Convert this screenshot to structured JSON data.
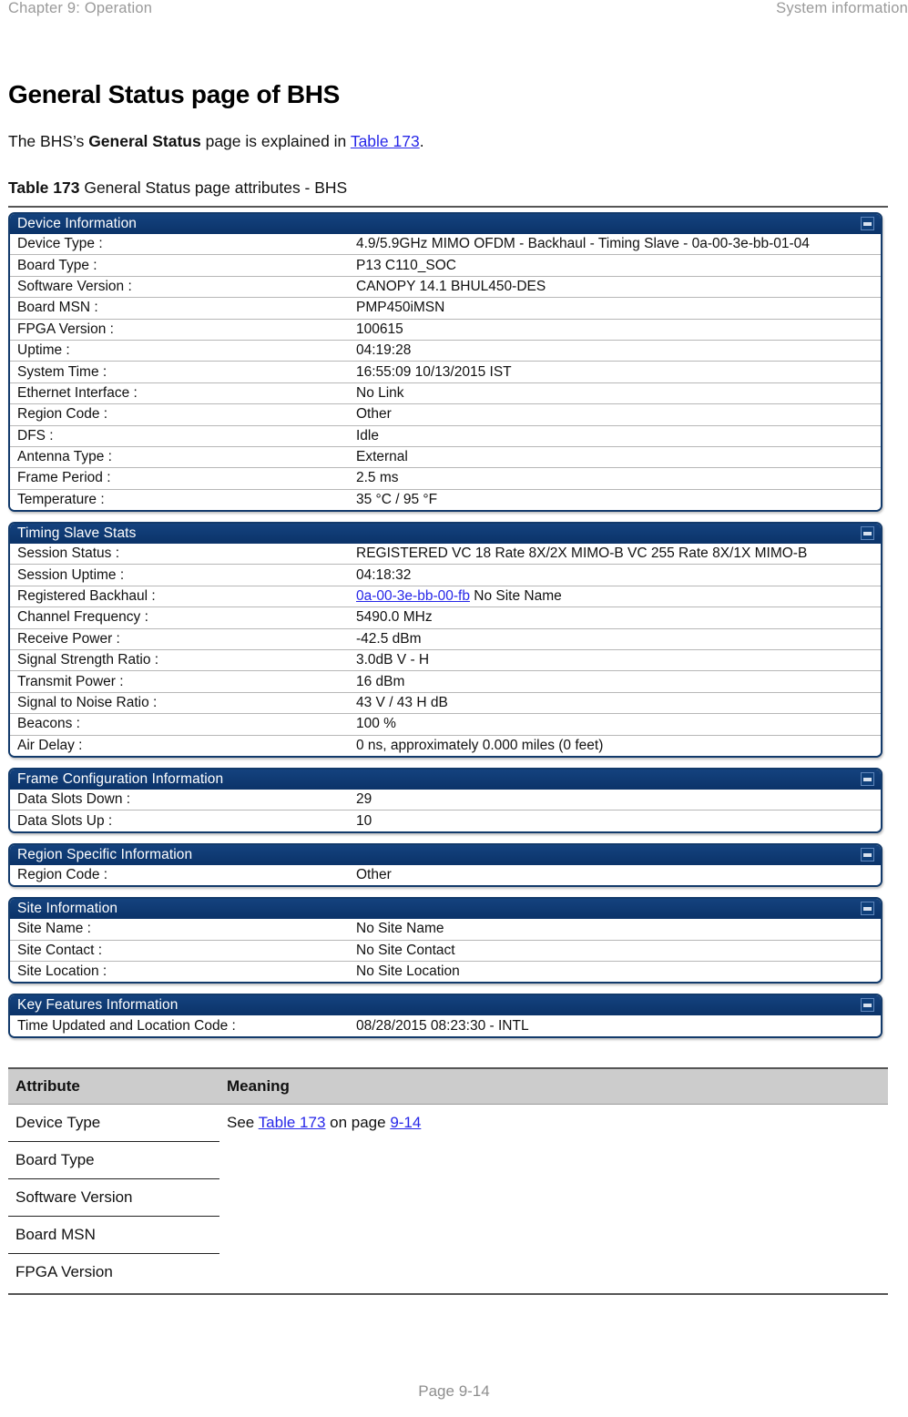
{
  "running_head": {
    "left": "Chapter 9:  Operation",
    "right": "System information"
  },
  "section": {
    "title": "General Status page of BHS",
    "intro_prefix": "The BHS’s ",
    "intro_bold": "General Status",
    "intro_middle": " page is explained in ",
    "intro_link": "Table 173",
    "intro_suffix": ".",
    "caption_label": "Table 173",
    "caption_text": " General Status page attributes - BHS"
  },
  "screenshot": {
    "panels": [
      {
        "title": "Device Information",
        "minimize_icon": "minimize-icon",
        "rows": [
          {
            "label": "Device Type :",
            "value": "4.9/5.9GHz MIMO OFDM - Backhaul - Timing Slave - 0a-00-3e-bb-01-04"
          },
          {
            "label": "Board Type :",
            "value": "P13 C110_SOC"
          },
          {
            "label": "Software Version :",
            "value": "CANOPY 14.1 BHUL450-DES"
          },
          {
            "label": "Board MSN :",
            "value": "PMP450iMSN"
          },
          {
            "label": "FPGA Version :",
            "value": "100615"
          },
          {
            "label": "Uptime :",
            "value": "04:19:28"
          },
          {
            "label": "System Time :",
            "value": "16:55:09 10/13/2015 IST"
          },
          {
            "label": "Ethernet Interface :",
            "value": "No Link"
          },
          {
            "label": "Region Code :",
            "value": "Other"
          },
          {
            "label": "DFS :",
            "value": "Idle"
          },
          {
            "label": "Antenna Type :",
            "value": "External"
          },
          {
            "label": "Frame Period :",
            "value": "2.5 ms"
          },
          {
            "label": "Temperature :",
            "value": "35 °C / 95 °F"
          }
        ]
      },
      {
        "title": "Timing Slave Stats",
        "minimize_icon": "minimize-icon",
        "rows": [
          {
            "label": "Session Status :",
            "value": "REGISTERED VC 18 Rate 8X/2X MIMO-B VC 255 Rate 8X/1X MIMO-B"
          },
          {
            "label": "Session Uptime :",
            "value": "04:18:32"
          },
          {
            "label": "Registered Backhaul :",
            "value": "",
            "link_text": "0a-00-3e-bb-00-fb",
            "value_after_link": " No Site Name"
          },
          {
            "label": "Channel Frequency :",
            "value": "5490.0 MHz"
          },
          {
            "label": "Receive Power :",
            "value": "-42.5 dBm"
          },
          {
            "label": "Signal Strength Ratio :",
            "value": "3.0dB V - H"
          },
          {
            "label": "Transmit Power :",
            "value": "16 dBm"
          },
          {
            "label": "Signal to Noise Ratio :",
            "value": "43 V / 43 H dB"
          },
          {
            "label": "Beacons :",
            "value": "100 %"
          },
          {
            "label": "Air Delay :",
            "value": "0 ns, approximately 0.000 miles (0 feet)"
          }
        ]
      },
      {
        "title": "Frame Configuration Information",
        "minimize_icon": "minimize-icon",
        "rows": [
          {
            "label": "Data Slots Down :",
            "value": "29"
          },
          {
            "label": "Data Slots Up :",
            "value": "10"
          }
        ]
      },
      {
        "title": "Region Specific Information",
        "minimize_icon": "minimize-icon",
        "rows": [
          {
            "label": "Region Code :",
            "value": "Other"
          }
        ]
      },
      {
        "title": "Site Information",
        "minimize_icon": "minimize-icon",
        "rows": [
          {
            "label": "Site Name :",
            "value": "No Site Name"
          },
          {
            "label": "Site Contact :",
            "value": "No Site Contact"
          },
          {
            "label": "Site Location :",
            "value": "No Site Location"
          }
        ]
      },
      {
        "title": "Key Features Information",
        "minimize_icon": "minimize-icon",
        "rows": [
          {
            "label": "Time Updated and Location Code :",
            "value": "08/28/2015 08:23:30 - INTL"
          }
        ]
      }
    ]
  },
  "attributes_table": {
    "headers": [
      "Attribute",
      "Meaning"
    ],
    "rows": [
      "Device Type",
      "Board Type",
      "Software Version",
      "Board MSN",
      "FPGA Version"
    ],
    "meaning_prefix": "See ",
    "meaning_link_table": "Table 173",
    "meaning_middle": " on page ",
    "meaning_link_page": "9-14"
  },
  "footer": {
    "page_label": "Page 9-14"
  },
  "colors": {
    "panel_header_bg": "#0d3b74",
    "panel_border": "#123a6b",
    "link_blue": "#2727e8",
    "table_header_bg": "#cccccc",
    "runhead_gray": "#9a9a9a"
  }
}
